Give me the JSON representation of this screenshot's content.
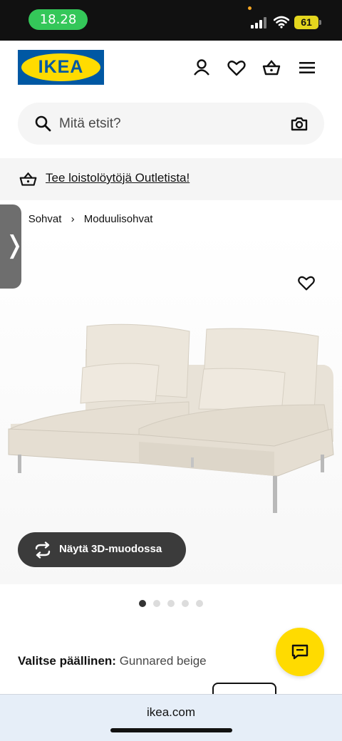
{
  "status_bar": {
    "time": "18.28",
    "battery": "61"
  },
  "header": {
    "logo_text": "IKEA",
    "icons": [
      "user-icon",
      "heart-icon",
      "basket-icon",
      "menu-icon"
    ]
  },
  "search": {
    "placeholder": "Mitä etsit?"
  },
  "banner": {
    "link_text": "Tee loistolöytöjä Outletista!"
  },
  "breadcrumb": {
    "items": [
      "..",
      "Sohvat",
      "Moduulisohvat"
    ],
    "separator": "›"
  },
  "side_tab": {
    "glyph": "❭"
  },
  "product": {
    "view_3d_label": "Näytä 3D-muodossa",
    "image_count": 5,
    "active_image_index": 0
  },
  "cover": {
    "label": "Valitse päällinen:",
    "value": "Gunnared beige"
  },
  "browser": {
    "url": "ikea.com"
  },
  "colors": {
    "brand_blue": "#0058a3",
    "brand_yellow": "#ffdb00",
    "sofa_fabric": "#e5ded2"
  }
}
